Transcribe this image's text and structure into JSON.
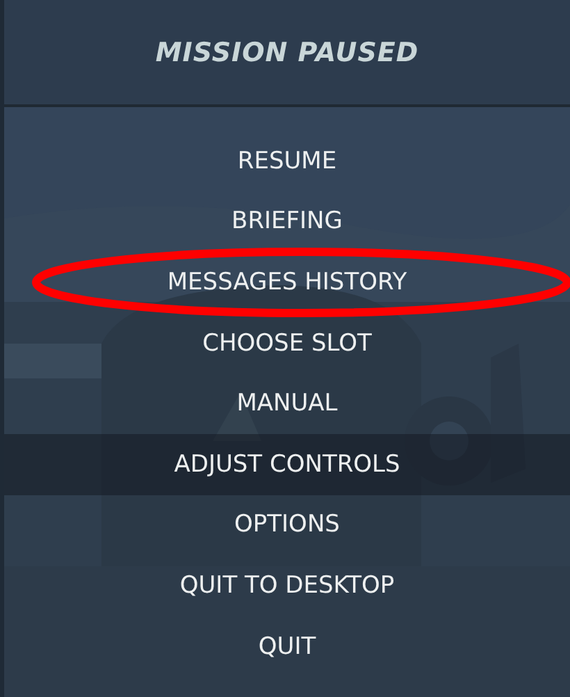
{
  "title": "MISSION PAUSED",
  "menu": [
    {
      "label": "RESUME",
      "selected": false,
      "circled": false
    },
    {
      "label": "BRIEFING",
      "selected": false,
      "circled": false
    },
    {
      "label": "MESSAGES HISTORY",
      "selected": false,
      "circled": true
    },
    {
      "label": "CHOOSE SLOT",
      "selected": false,
      "circled": false
    },
    {
      "label": "MANUAL",
      "selected": false,
      "circled": false
    },
    {
      "label": "ADJUST CONTROLS",
      "selected": true,
      "circled": false
    },
    {
      "label": "OPTIONS",
      "selected": false,
      "circled": false
    },
    {
      "label": "QUIT TO DESKTOP",
      "selected": false,
      "circled": false
    },
    {
      "label": "QUIT",
      "selected": false,
      "circled": false
    }
  ]
}
